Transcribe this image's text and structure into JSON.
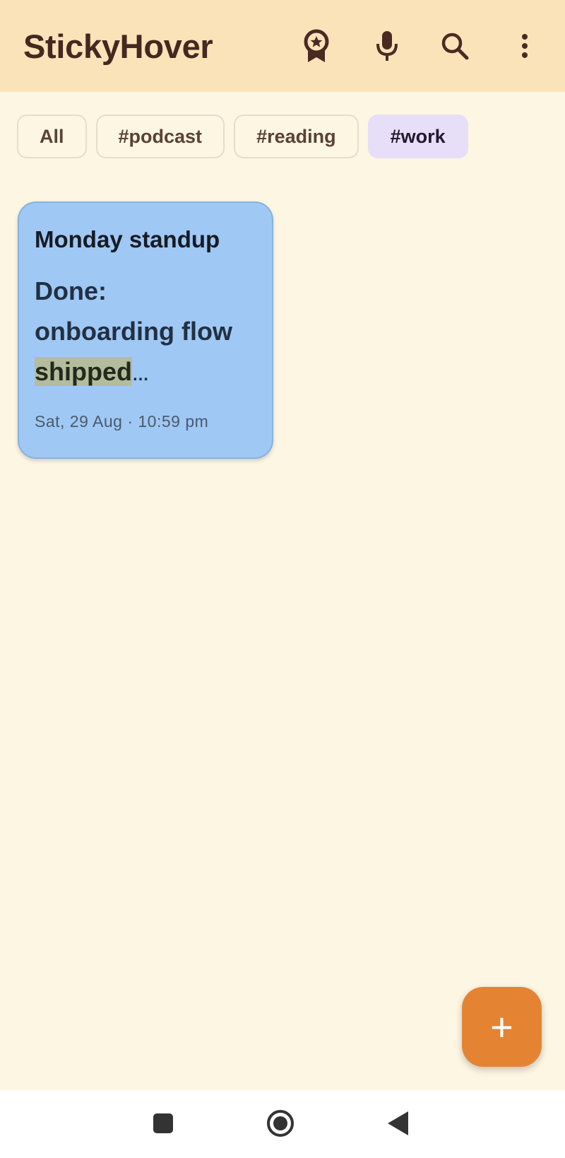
{
  "app": {
    "title": "StickyHover"
  },
  "toolbar": {
    "icons": [
      "badge-icon",
      "microphone-icon",
      "search-icon",
      "more-vert-icon"
    ]
  },
  "filters": {
    "chips": [
      "All",
      "#podcast",
      "#reading",
      "#work"
    ],
    "selected": "#work"
  },
  "notes": [
    {
      "title": "Monday standup",
      "body_prefix": "Done:",
      "body_line2": "onboarding flow",
      "body_highlight": "shipped",
      "body_ellipsis": "…",
      "date": "Sat, 29 Aug · 10:59 pm",
      "color": "#9fc8f4"
    }
  ],
  "fab": {
    "label": "+"
  },
  "system_nav": {
    "icons": [
      "recents-icon",
      "home-icon",
      "back-icon"
    ]
  },
  "colors": {
    "appbar": "#fbe3b9",
    "background": "#fdf6e3",
    "accent": "#e48433",
    "chip_selected": "#e6dff7",
    "highlight": "#b3bd9d"
  }
}
